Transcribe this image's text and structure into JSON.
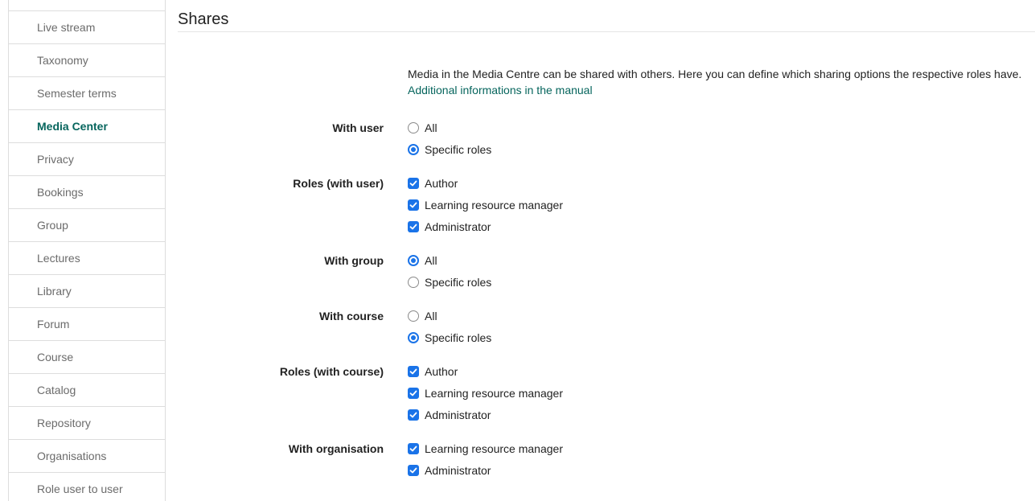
{
  "sidebar": {
    "items": [
      {
        "label": "",
        "active": false
      },
      {
        "label": "Live stream",
        "active": false
      },
      {
        "label": "Taxonomy",
        "active": false
      },
      {
        "label": "Semester terms",
        "active": false
      },
      {
        "label": "Media Center",
        "active": true
      },
      {
        "label": "Privacy",
        "active": false
      },
      {
        "label": "Bookings",
        "active": false
      },
      {
        "label": "Group",
        "active": false
      },
      {
        "label": "Lectures",
        "active": false
      },
      {
        "label": "Library",
        "active": false
      },
      {
        "label": "Forum",
        "active": false
      },
      {
        "label": "Course",
        "active": false
      },
      {
        "label": "Catalog",
        "active": false
      },
      {
        "label": "Repository",
        "active": false
      },
      {
        "label": "Organisations",
        "active": false
      },
      {
        "label": "Role user to user",
        "active": false
      }
    ]
  },
  "main": {
    "title": "Shares",
    "intro_text": "Media in the Media Centre can be shared with others. Here you can define which sharing options the respective roles have.",
    "manual_link": "Additional informations in the manual",
    "sections": [
      {
        "label": "With user",
        "type": "radio",
        "options": [
          {
            "label": "All",
            "checked": false
          },
          {
            "label": "Specific roles",
            "checked": true
          }
        ]
      },
      {
        "label": "Roles (with user)",
        "type": "checkbox",
        "options": [
          {
            "label": "Author",
            "checked": true
          },
          {
            "label": "Learning resource manager",
            "checked": true
          },
          {
            "label": "Administrator",
            "checked": true
          }
        ]
      },
      {
        "label": "With group",
        "type": "radio",
        "options": [
          {
            "label": "All",
            "checked": true
          },
          {
            "label": "Specific roles",
            "checked": false
          }
        ]
      },
      {
        "label": "With course",
        "type": "radio",
        "options": [
          {
            "label": "All",
            "checked": false
          },
          {
            "label": "Specific roles",
            "checked": true
          }
        ]
      },
      {
        "label": "Roles (with course)",
        "type": "checkbox",
        "options": [
          {
            "label": "Author",
            "checked": true
          },
          {
            "label": "Learning resource manager",
            "checked": true
          },
          {
            "label": "Administrator",
            "checked": true
          }
        ]
      },
      {
        "label": "With organisation",
        "type": "checkbox",
        "options": [
          {
            "label": "Learning resource manager",
            "checked": true
          },
          {
            "label": "Administrator",
            "checked": true
          }
        ]
      }
    ]
  },
  "colors": {
    "accent": "#06655d",
    "control": "#1a73e8"
  }
}
